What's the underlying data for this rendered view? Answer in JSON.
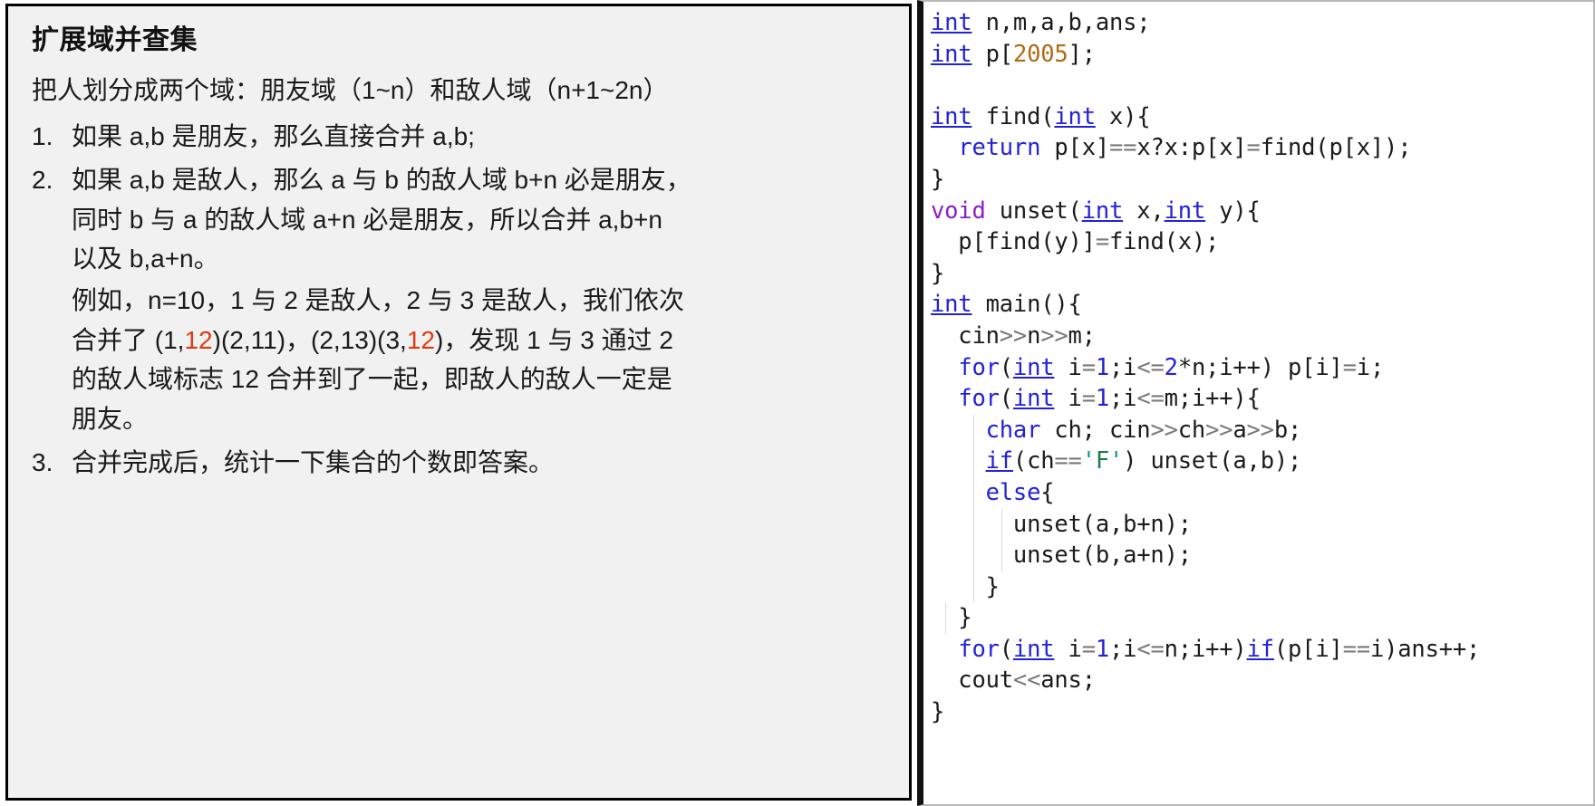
{
  "note": {
    "title": "扩展域并查集",
    "lead": "把人划分成两个域：朋友域（1~n）和敌人域（n+1~2n）",
    "items": [
      {
        "num": "1.",
        "lines": [
          "如果 a,b 是朋友，那么直接合并 a,b;"
        ]
      },
      {
        "num": "2.",
        "lines": [
          "如果 a,b 是敌人，那么 a 与 b 的敌人域 b+n 必是朋友，",
          "同时 b 与 a 的敌人域 a+n 必是朋友，所以合并 a,b+n",
          "以及 b,a+n。"
        ],
        "example": {
          "line1": "例如，n=10，1 与 2 是敌人，2 与 3 是敌人，我们依次",
          "line2_pre": "合并了 (1,",
          "line2_red1": "12",
          "line2_mid": ")(2,11)，(2,13)(3,",
          "line2_red2": "12",
          "line2_post": ")，发现 1 与 3 通过 2",
          "line3": "的敌人域标志 12 合并到了一起，即敌人的敌人一定是",
          "line4": "朋友。"
        }
      },
      {
        "num": "3.",
        "lines": [
          "合并完成后，统计一下集合的个数即答案。"
        ]
      }
    ]
  },
  "code": {
    "language": "cpp",
    "lines": [
      {
        "tokens": [
          {
            "t": "int",
            "c": "kwu"
          },
          {
            "t": " n,m,a,b,ans;",
            "c": "plain"
          }
        ]
      },
      {
        "tokens": [
          {
            "t": "int",
            "c": "kwu"
          },
          {
            "t": " p[",
            "c": "plain"
          },
          {
            "t": "2005",
            "c": "numo"
          },
          {
            "t": "];",
            "c": "plain"
          }
        ]
      },
      {
        "tokens": []
      },
      {
        "tokens": [
          {
            "t": "int",
            "c": "kwu"
          },
          {
            "t": " find(",
            "c": "plain"
          },
          {
            "t": "int",
            "c": "kwu"
          },
          {
            "t": " x){",
            "c": "plain"
          }
        ]
      },
      {
        "tokens": [
          {
            "t": "  ",
            "c": "plain"
          },
          {
            "t": "return",
            "c": "kw"
          },
          {
            "t": " p[x]",
            "c": "plain"
          },
          {
            "t": "==",
            "c": "op"
          },
          {
            "t": "x?x:p[x]",
            "c": "plain"
          },
          {
            "t": "=",
            "c": "op"
          },
          {
            "t": "find(p[x]);",
            "c": "plain"
          }
        ]
      },
      {
        "tokens": [
          {
            "t": "}",
            "c": "plain"
          }
        ]
      },
      {
        "tokens": [
          {
            "t": "void",
            "c": "type-v"
          },
          {
            "t": " unset(",
            "c": "plain"
          },
          {
            "t": "int",
            "c": "kwu"
          },
          {
            "t": " x,",
            "c": "plain"
          },
          {
            "t": "int",
            "c": "kwu"
          },
          {
            "t": " y){",
            "c": "plain"
          }
        ]
      },
      {
        "tokens": [
          {
            "t": "  p[find(y)]",
            "c": "plain"
          },
          {
            "t": "=",
            "c": "op"
          },
          {
            "t": "find(x);",
            "c": "plain"
          }
        ]
      },
      {
        "tokens": [
          {
            "t": "}",
            "c": "plain"
          }
        ]
      },
      {
        "tokens": [
          {
            "t": "int",
            "c": "kwu"
          },
          {
            "t": " main(){",
            "c": "plain"
          }
        ]
      },
      {
        "tokens": [
          {
            "t": "  cin",
            "c": "plain"
          },
          {
            "t": ">>",
            "c": "op"
          },
          {
            "t": "n",
            "c": "plain"
          },
          {
            "t": ">>",
            "c": "op"
          },
          {
            "t": "m;",
            "c": "plain"
          }
        ]
      },
      {
        "tokens": [
          {
            "t": "  ",
            "c": "plain"
          },
          {
            "t": "for",
            "c": "kw"
          },
          {
            "t": "(",
            "c": "plain"
          },
          {
            "t": "int",
            "c": "kwu"
          },
          {
            "t": " i",
            "c": "plain"
          },
          {
            "t": "=",
            "c": "op"
          },
          {
            "t": "1",
            "c": "num"
          },
          {
            "t": ";i",
            "c": "plain"
          },
          {
            "t": "<=",
            "c": "op"
          },
          {
            "t": "2",
            "c": "num"
          },
          {
            "t": "*n;i++) p[i]",
            "c": "plain"
          },
          {
            "t": "=",
            "c": "op"
          },
          {
            "t": "i;",
            "c": "plain"
          }
        ]
      },
      {
        "tokens": [
          {
            "t": "  ",
            "c": "plain"
          },
          {
            "t": "for",
            "c": "kw"
          },
          {
            "t": "(",
            "c": "plain"
          },
          {
            "t": "int",
            "c": "kwu"
          },
          {
            "t": " i",
            "c": "plain"
          },
          {
            "t": "=",
            "c": "op"
          },
          {
            "t": "1",
            "c": "num"
          },
          {
            "t": ";i",
            "c": "plain"
          },
          {
            "t": "<=",
            "c": "op"
          },
          {
            "t": "m;i++){",
            "c": "plain"
          }
        ]
      },
      {
        "tokens": [
          {
            "t": "    ",
            "c": "plain"
          },
          {
            "t": "char",
            "c": "kw"
          },
          {
            "t": " ch; cin",
            "c": "plain"
          },
          {
            "t": ">>",
            "c": "op"
          },
          {
            "t": "ch",
            "c": "plain"
          },
          {
            "t": ">>",
            "c": "op"
          },
          {
            "t": "a",
            "c": "plain"
          },
          {
            "t": ">>",
            "c": "op"
          },
          {
            "t": "b;",
            "c": "plain"
          }
        ]
      },
      {
        "tokens": [
          {
            "t": "    ",
            "c": "plain"
          },
          {
            "t": "if",
            "c": "kwu"
          },
          {
            "t": "(ch",
            "c": "plain"
          },
          {
            "t": "==",
            "c": "op"
          },
          {
            "t": "'",
            "c": "quote"
          },
          {
            "t": "F",
            "c": "str"
          },
          {
            "t": "'",
            "c": "quote"
          },
          {
            "t": ") unset(a,b);",
            "c": "plain"
          }
        ]
      },
      {
        "tokens": [
          {
            "t": "    ",
            "c": "plain"
          },
          {
            "t": "else",
            "c": "kw"
          },
          {
            "t": "{",
            "c": "plain"
          }
        ]
      },
      {
        "tokens": [
          {
            "t": "      unset(a,b+n);",
            "c": "plain"
          }
        ]
      },
      {
        "tokens": [
          {
            "t": "      unset(b,a+n);",
            "c": "plain"
          }
        ]
      },
      {
        "tokens": [
          {
            "t": "    }",
            "c": "plain"
          }
        ]
      },
      {
        "tokens": [
          {
            "t": "  }",
            "c": "plain"
          }
        ]
      },
      {
        "tokens": [
          {
            "t": "  ",
            "c": "plain"
          },
          {
            "t": "for",
            "c": "kw"
          },
          {
            "t": "(",
            "c": "plain"
          },
          {
            "t": "int",
            "c": "kwu"
          },
          {
            "t": " i",
            "c": "plain"
          },
          {
            "t": "=",
            "c": "op"
          },
          {
            "t": "1",
            "c": "num"
          },
          {
            "t": ";i",
            "c": "plain"
          },
          {
            "t": "<=",
            "c": "op"
          },
          {
            "t": "n;i++)",
            "c": "plain"
          },
          {
            "t": "if",
            "c": "kwu"
          },
          {
            "t": "(p[i]",
            "c": "plain"
          },
          {
            "t": "==",
            "c": "op"
          },
          {
            "t": "i)ans++;",
            "c": "plain"
          }
        ]
      },
      {
        "tokens": [
          {
            "t": "  cout",
            "c": "plain"
          },
          {
            "t": "<<",
            "c": "op"
          },
          {
            "t": "ans;",
            "c": "plain"
          }
        ]
      },
      {
        "tokens": [
          {
            "t": "}",
            "c": "plain"
          }
        ]
      }
    ],
    "indent_guides": [
      {
        "line": 13,
        "cols": [
          3
        ]
      },
      {
        "line": 14,
        "cols": [
          3
        ]
      },
      {
        "line": 15,
        "cols": [
          3
        ]
      },
      {
        "line": 16,
        "cols": [
          3,
          5
        ]
      },
      {
        "line": 17,
        "cols": [
          3,
          5
        ]
      },
      {
        "line": 18,
        "cols": [
          3
        ]
      },
      {
        "line": 19,
        "cols": [
          1
        ]
      }
    ]
  },
  "colors": {
    "note_background": "#f1f1f1",
    "note_border": "#000000",
    "highlight_red": "#e03a10",
    "keyword_blue": "#2222dd",
    "type_purple": "#8b1fc9",
    "number_orange": "#b06a12",
    "string_green": "#1d7a4a",
    "operator_gray": "#7a7a7a",
    "code_background": "#ffffff"
  }
}
